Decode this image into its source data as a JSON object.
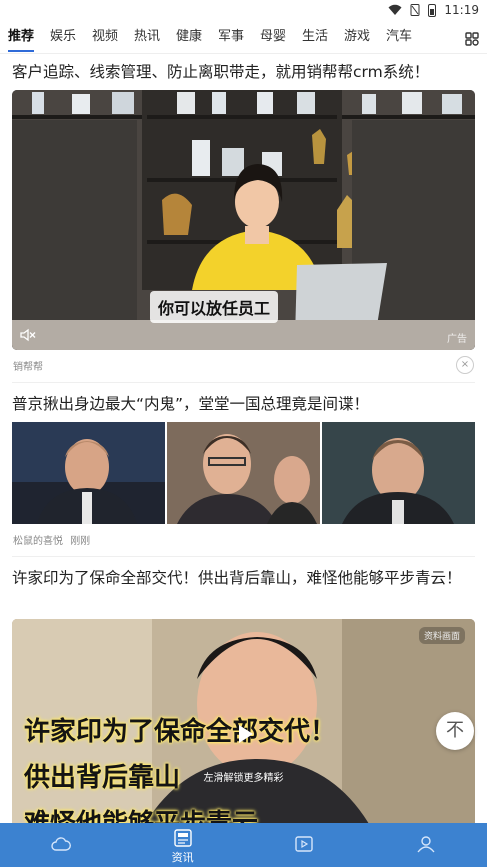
{
  "status_bar": {
    "time": "11:19"
  },
  "tabs": [
    "推荐",
    "娱乐",
    "视频",
    "热讯",
    "健康",
    "军事",
    "母婴",
    "生活",
    "游戏",
    "汽车"
  ],
  "feed": {
    "ad": {
      "title": "客户追踪、线索管理、防止离职带走，就用销帮帮crm系统！",
      "video_caption": "你可以放任员工",
      "ad_tag": "广告",
      "source": "销帮帮",
      "close": "×"
    },
    "news1": {
      "title": "普京揪出身边最大“内鬼”，堂堂一国总理竟是间谍！",
      "source": "松鼠的喜悦",
      "time": "刚刚"
    },
    "news2": {
      "title": "许家印为了保命全部交代！供出背后靠山，难怪他能够平步青云！",
      "source_tag": "资料画面",
      "subtitle_lines": [
        "许家印为了保命全部交代！",
        "供出背后靠山",
        "难怪他能够平步青云"
      ],
      "swipe_hint": "左滑解锁更多精彩"
    }
  },
  "float_button": {
    "label": "不"
  },
  "bottom_nav": {
    "items": [
      {
        "icon": "cloud-icon",
        "label": ""
      },
      {
        "icon": "news-icon",
        "label": "资讯"
      },
      {
        "icon": "video-icon",
        "label": ""
      },
      {
        "icon": "user-icon",
        "label": ""
      }
    ]
  },
  "colors": {
    "accent": "#3c82d0",
    "tab_underline": "#2f6bd8"
  }
}
